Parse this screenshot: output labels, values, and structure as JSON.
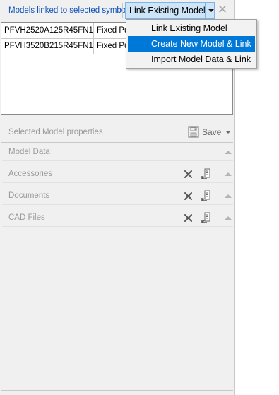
{
  "header": {
    "label": "Models linked to selected symbol",
    "link_button_label": "Link Existing Model",
    "close_glyph": "✕"
  },
  "linked_models": {
    "rows": [
      {
        "name": "PFVH2520A125R45FN1",
        "type": "Fixed  Pu"
      },
      {
        "name": "PFVH3520B215R45FN1",
        "type": "Fixed  Pu"
      }
    ]
  },
  "dropdown_menu": {
    "items": [
      {
        "label": "Link Existing Model",
        "highlighted": false
      },
      {
        "label": "Create New Model & Link",
        "highlighted": true
      },
      {
        "label": "Import Model Data & Link",
        "highlighted": false
      }
    ]
  },
  "properties": {
    "title": "Selected Model properties",
    "save_label": "Save",
    "sections": [
      {
        "title": "Model Data",
        "has_actions": false
      },
      {
        "title": "Accessories",
        "has_actions": true
      },
      {
        "title": "Documents",
        "has_actions": true
      },
      {
        "title": "CAD Files",
        "has_actions": true
      }
    ]
  },
  "colors": {
    "header_label": "#0b4fb8",
    "menu_highlight": "#0078d7",
    "button_hover_fill": "#cde5f7",
    "muted_text": "#9a9a9a"
  },
  "icons": {
    "dropdown": "chevron-down-icon",
    "close": "close-icon",
    "save": "floppy-disk-icon",
    "delete": "x-delete-icon",
    "attach": "attach-document-icon",
    "collapse": "triangle-up-icon"
  }
}
